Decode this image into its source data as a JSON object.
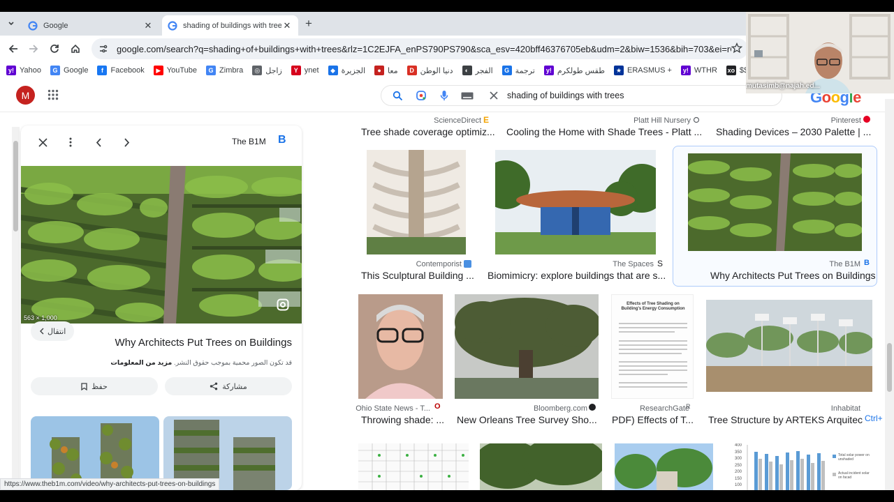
{
  "browser": {
    "tabs": [
      {
        "title": "Google"
      },
      {
        "title": "shading of buildings with trees"
      }
    ],
    "url": "google.com/search?q=shading+of+buildings+with+trees&rlz=1C2EJFA_enPS790PS790&sca_esv=420bff46376705eb&udm=2&biw=1536&bih=703&ei=rQzbZe72Nt2rkd..."
  },
  "bookmarks": [
    {
      "label": "Yahoo",
      "color": "#6001d2",
      "glyph": "y!"
    },
    {
      "label": "Google",
      "color": "#4285f4",
      "glyph": "G"
    },
    {
      "label": "Facebook",
      "color": "#1877f2",
      "glyph": "f"
    },
    {
      "label": "YouTube",
      "color": "#ff0000",
      "glyph": "▶"
    },
    {
      "label": "Zimbra",
      "color": "#4285f4",
      "glyph": "G"
    },
    {
      "label": "زاجل",
      "color": "#5f6368",
      "glyph": "◎"
    },
    {
      "label": "ynet",
      "color": "#d6001c",
      "glyph": "Y"
    },
    {
      "label": "الجزيرة",
      "color": "#1a73e8",
      "glyph": "◆"
    },
    {
      "label": "معا",
      "color": "#c5221f",
      "glyph": "●"
    },
    {
      "label": "دنيا الوطن",
      "color": "#d93025",
      "glyph": "D"
    },
    {
      "label": "الفجر",
      "color": "#3c4043",
      "glyph": "◐"
    },
    {
      "label": "ترجمة",
      "color": "#1a73e8",
      "glyph": "G"
    },
    {
      "label": "طقس طولكرم",
      "color": "#6001d2",
      "glyph": "y!"
    },
    {
      "label": "ERASMUS +",
      "color": "#003399",
      "glyph": "★"
    },
    {
      "label": "WTHR",
      "color": "#6001d2",
      "glyph": "y!"
    },
    {
      "label": "$$$",
      "color": "#202124",
      "glyph": "xo"
    }
  ],
  "google": {
    "avatar_letter": "M",
    "query": "shading of buildings with trees",
    "logo": "Google"
  },
  "panel": {
    "source": "The B1M",
    "source_logo": "B",
    "dimensions": "563 × 1,000",
    "visit_label": "انتقال",
    "title": "Why Architects Put Trees on Buildings",
    "note_prefix": "قد تكون الصور محمية بموجب حقوق النشر.",
    "note_link": "مزيد من المعلومات",
    "save_label": "حفظ",
    "share_label": "مشاركة"
  },
  "results": {
    "row0": [
      {
        "source": "ScienceDirect",
        "title": "Tree shade coverage optimiz..."
      },
      {
        "source": "Platt Hill Nursery",
        "title": "Cooling the Home with Shade Trees - Platt ..."
      },
      {
        "source": "Pinterest",
        "title": "Shading Devices – 2030 Palette | ..."
      }
    ],
    "row1": [
      {
        "source": "Contemporist",
        "title": "This Sculptural Building ..."
      },
      {
        "source": "The Spaces",
        "title": "Biomimicry: explore buildings that are s..."
      },
      {
        "source": "The B1M",
        "title": "Why Architects Put Trees on Buildings"
      }
    ],
    "row2": [
      {
        "source": "Ohio State News - T...",
        "title": "Throwing shade: ..."
      },
      {
        "source": "Bloomberg.com",
        "title": "New Orleans Tree Survey Sho..."
      },
      {
        "source": "ResearchGate",
        "title": "PDF) Effects of T..."
      },
      {
        "source": "Inhabitat",
        "title": "Tree Structure by ARTEKS Arquitec..."
      }
    ]
  },
  "doc_thumb_title": "Effects of Tree Shading on Building's Energy Consumption",
  "chart_thumb_ticks": [
    "400",
    "350",
    "300",
    "250",
    "200",
    "150",
    "100"
  ],
  "chart_thumb_legend": [
    "Total solar power on unshaded",
    "Actual incident solar on facad"
  ],
  "find_hint": "Ctrl+",
  "status_url": "https://www.theb1m.com/video/why-architects-put-trees-on-buildings",
  "webcam_label": "mutasimb@najah.ed..."
}
